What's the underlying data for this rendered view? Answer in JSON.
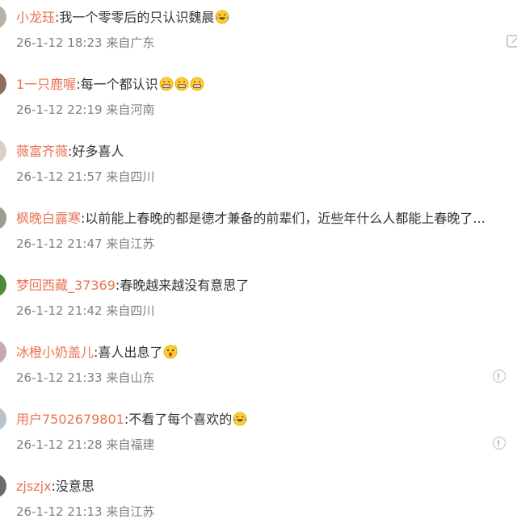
{
  "comments": [
    {
      "author": "小龙珏",
      "separator": ":",
      "text": "我一个零零后的只认识魏晨",
      "emoji_count": 1,
      "emoji": "laugh-cry-emoji",
      "date": "26-1-12 18:23",
      "location": "来自广东",
      "avatar_color": "#b9b0a6",
      "has_report": false,
      "has_edit": true
    },
    {
      "author": "1一只鹿喔",
      "separator": ":",
      "text": "每一个都认识",
      "emoji_count": 3,
      "emoji": "grin-emoji",
      "date": "26-1-12 22:19",
      "location": "来自河南",
      "avatar_color": "#8a6f60",
      "has_report": false,
      "has_edit": false
    },
    {
      "author": "薇富齐薇",
      "separator": ":",
      "text": "好多喜人",
      "emoji_count": 0,
      "emoji": "",
      "date": "26-1-12 21:57",
      "location": "来自四川",
      "avatar_color": "#d8cfc6",
      "has_report": false,
      "has_edit": false
    },
    {
      "author": "枫晚白露寒",
      "separator": ":",
      "text": "以前能上春晚的都是德才兼备的前辈们，近些年什么人都能上春晚了...",
      "emoji_count": 0,
      "emoji": "",
      "date": "26-1-12 21:47",
      "location": "来自江苏",
      "avatar_color": "#9e9a94",
      "has_report": false,
      "has_edit": false
    },
    {
      "author": "梦回西藏_37369",
      "separator": ":",
      "text": "春晚越来越没有意思了",
      "emoji_count": 0,
      "emoji": "",
      "date": "26-1-12 21:42",
      "location": "来自四川",
      "avatar_color": "#4f8a3a",
      "has_report": false,
      "has_edit": false
    },
    {
      "author": "冰橙小奶盖儿",
      "separator": ":",
      "text": "喜人出息了",
      "emoji_count": 1,
      "emoji": "surprised-emoji",
      "date": "26-1-12 21:33",
      "location": "来自山东",
      "avatar_color": "#c9a6b8",
      "has_report": true,
      "has_edit": false
    },
    {
      "author": "用户7502679801",
      "separator": ":",
      "text": "不看了每个喜欢的",
      "emoji_count": 1,
      "emoji": "laugh-cry-emoji",
      "date": "26-1-12 21:28",
      "location": "来自福建",
      "avatar_color": "#b8c2cc",
      "has_report": true,
      "has_edit": false
    },
    {
      "author": "zjszjx",
      "separator": ":",
      "text": "没意思",
      "emoji_count": 0,
      "emoji": "",
      "date": "26-1-12 21:13",
      "location": "来自江苏",
      "avatar_color": "#6e6a66",
      "has_report": false,
      "has_edit": false
    }
  ],
  "colors": {
    "author": "#eb7350",
    "text": "#333333",
    "meta": "#808080",
    "icon": "#bcbcbc"
  }
}
